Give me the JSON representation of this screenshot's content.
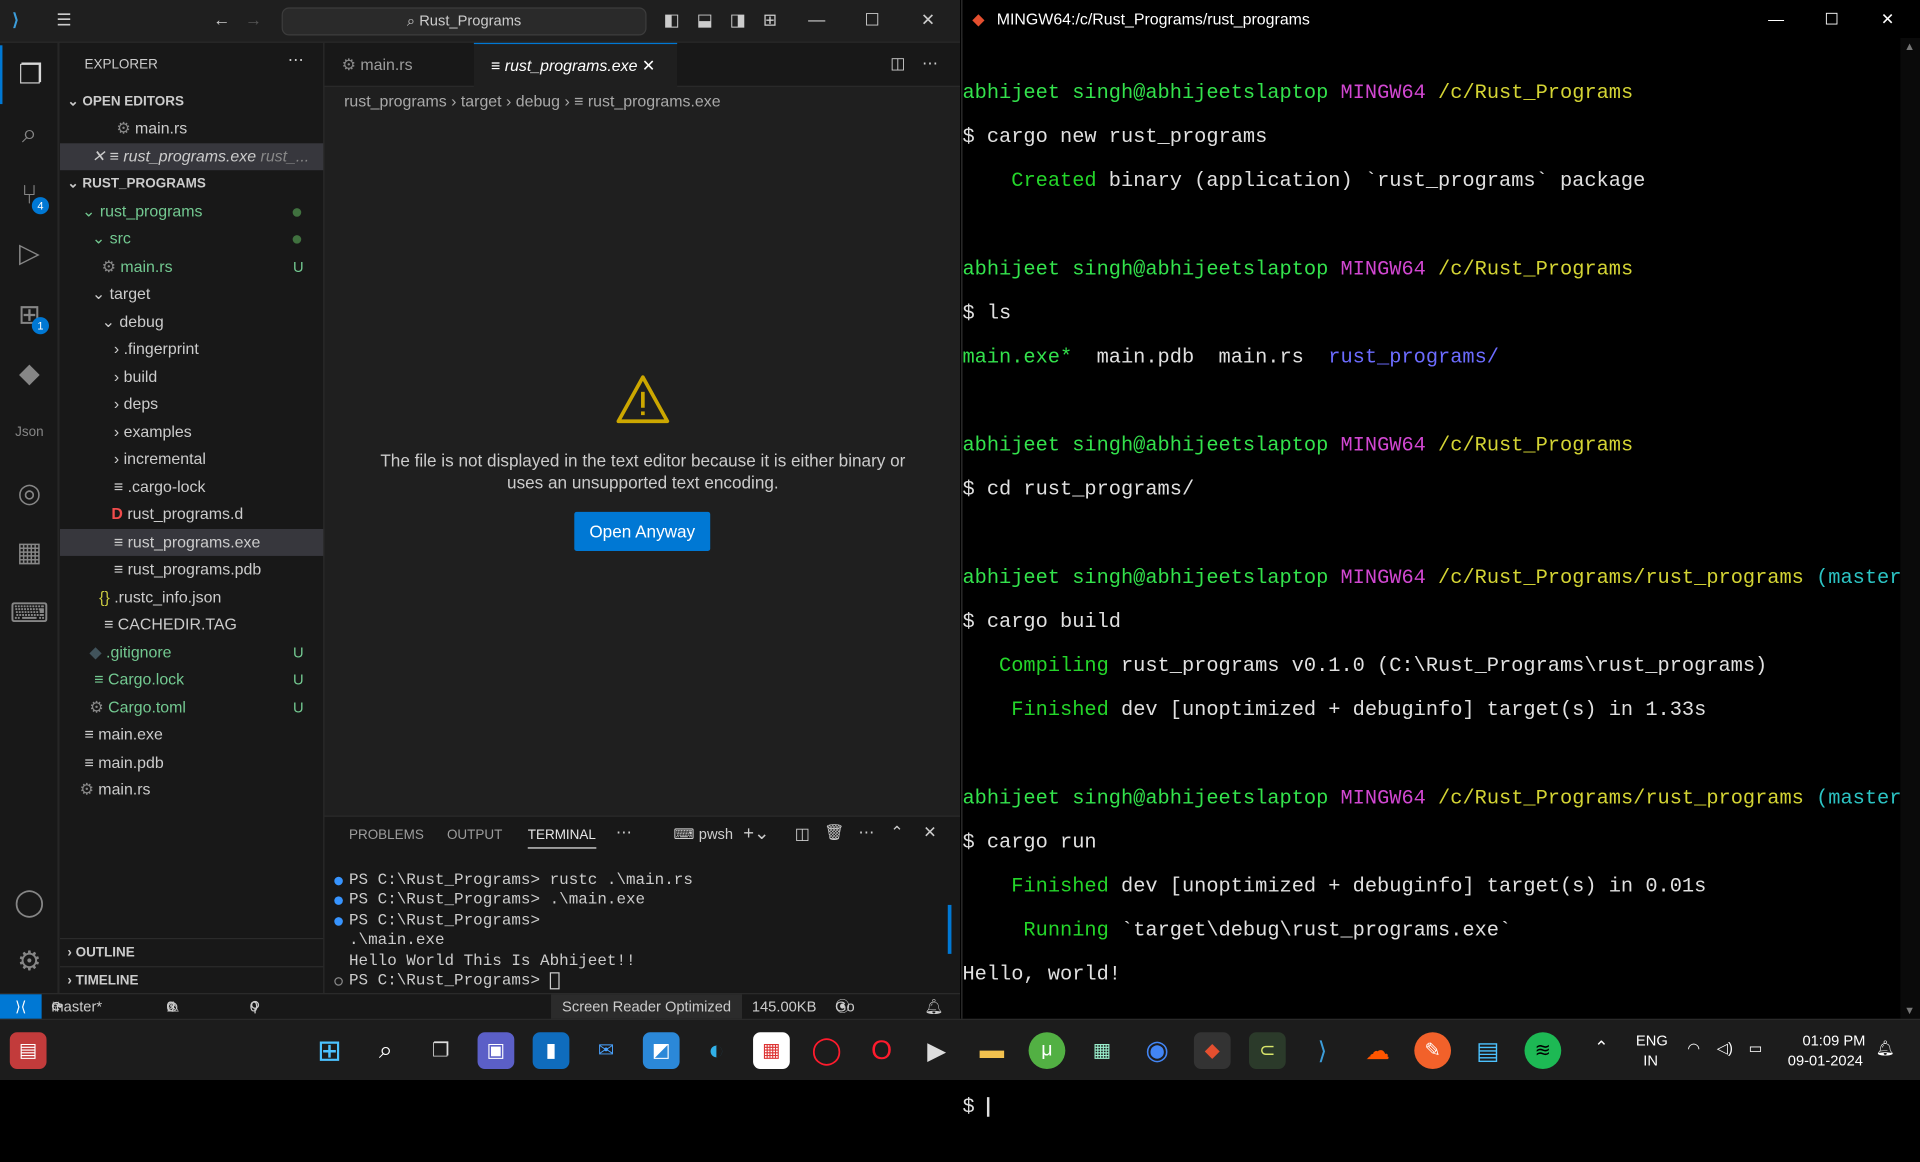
{
  "vscode": {
    "search": "Rust_Programs",
    "explorer_title": "EXPLORER",
    "open_editors": "OPEN EDITORS",
    "open_editor_items": [
      "main.rs",
      "rust_programs.exe",
      "rust_..."
    ],
    "project": "RUST_PROGRAMS",
    "tree": {
      "rust_programs": "rust_programs",
      "src": "src",
      "main_rs": "main.rs",
      "target": "target",
      "debug": "debug",
      "fingerprint": ".fingerprint",
      "build": "build",
      "deps": "deps",
      "examples": "examples",
      "incremental": "incremental",
      "cargo_lock_dot": ".cargo-lock",
      "rust_programs_d": "rust_programs.d",
      "rust_programs_exe": "rust_programs.exe",
      "rust_programs_pdb": "rust_programs.pdb",
      "rustc_info": ".rustc_info.json",
      "cachedir": "CACHEDIR.TAG",
      "gitignore": ".gitignore",
      "cargo_lock": "Cargo.lock",
      "cargo_toml": "Cargo.toml",
      "main_exe": "main.exe",
      "main_pdb": "main.pdb",
      "main_rs2": "main.rs"
    },
    "badge_u": "U",
    "outline": "OUTLINE",
    "timeline": "TIMELINE",
    "tabs": [
      "main.rs",
      "rust_programs.exe"
    ],
    "breadcrumb": [
      "rust_programs",
      "target",
      "debug",
      "rust_programs.exe"
    ],
    "binary_message": "The file is not displayed in the text editor because it is either binary or uses an unsupported text encoding.",
    "open_anyway": "Open Anyway",
    "panel_tabs": [
      "PROBLEMS",
      "OUTPUT",
      "TERMINAL"
    ],
    "shell": "pwsh",
    "terminal_lines": [
      "PS C:\\Rust_Programs> rustc .\\main.rs",
      "PS C:\\Rust_Programs> .\\main.exe",
      "PS C:\\Rust_Programs>",
      ".\\main.exe",
      "Hello World This Is Abhijeet!!",
      "PS C:\\Rust_Programs> "
    ],
    "status": {
      "branch": "master*",
      "errors": "0",
      "warnings": "0",
      "ports": "0",
      "screen_reader": "Screen Reader Optimized",
      "size": "145.00KB",
      "golive": "Go Live"
    },
    "scm_badge": "4",
    "ext_badge": "1"
  },
  "mingw": {
    "title": "MINGW64:/c/Rust_Programs/rust_programs",
    "user": "abhijeet singh@abhijeetslaptop",
    "sys": "MINGW64",
    "path1": "/c/Rust_Programs",
    "path2": "/c/Rust_Programs/rust_programs",
    "branch": "(master",
    "cmd1": "$ cargo new rust_programs",
    "created_kw": "Created",
    "created_rest": " binary (application) `rust_programs` package",
    "cmd2": "$ ls",
    "ls_exe": "main.exe*",
    "ls_mid": "  main.pdb  main.rs  ",
    "ls_dir": "rust_programs/",
    "cmd3": "$ cd rust_programs/",
    "cmd4": "$ cargo build",
    "compiling_kw": "Compiling",
    "compiling_rest": " rust_programs v0.1.0 (C:\\Rust_Programs\\rust_programs)",
    "finished_kw": "Finished",
    "finished1_rest": " dev [unoptimized + debuginfo] target(s) in 1.33s",
    "cmd5": "$ cargo run",
    "finished2_rest": " dev [unoptimized + debuginfo] target(s) in 0.01s",
    "running_kw": "Running",
    "running_rest": " `target\\debug\\rust_programs.exe`",
    "hello": "Hello, world!",
    "prompt": "$ "
  },
  "taskbar": {
    "lang1": "ENG",
    "lang2": "IN",
    "time": "01:09 PM",
    "date": "09-01-2024"
  }
}
